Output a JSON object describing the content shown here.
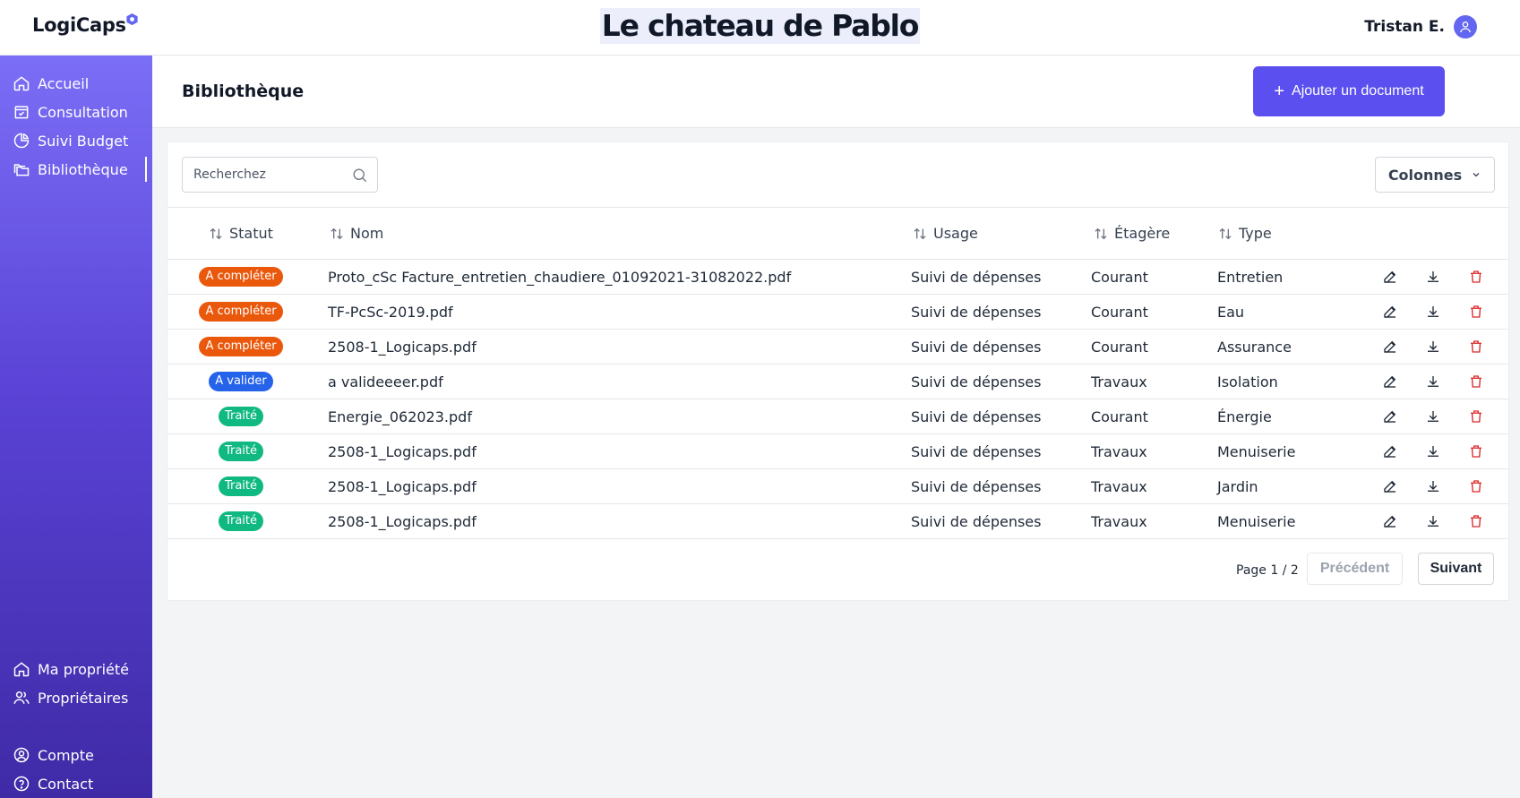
{
  "header": {
    "logo": "LogiCaps",
    "site_title": "Le chateau de Pablo",
    "user_name": "Tristan E.",
    "logo_icon": "hexagon-icon",
    "avatar_icon": "user-icon"
  },
  "sidebar": {
    "top_items": [
      {
        "label": "Accueil",
        "icon": "home-icon"
      },
      {
        "label": "Consultation",
        "icon": "calendar-check-icon"
      },
      {
        "label": "Suivi Budget",
        "icon": "pie-chart-icon"
      },
      {
        "label": "Bibliothèque",
        "icon": "folders-icon",
        "active": true
      }
    ],
    "bottom_items": [
      {
        "label": "Ma propriété",
        "icon": "home-icon"
      },
      {
        "label": "Propriétaires",
        "icon": "users-icon"
      },
      {
        "label": "Compte",
        "icon": "user-circle-icon"
      },
      {
        "label": "Contact",
        "icon": "help-circle-icon"
      }
    ]
  },
  "page": {
    "title": "Bibliothèque",
    "add_button": "Ajouter un document"
  },
  "toolbar": {
    "search_placeholder": "Recherchez",
    "columns_button": "Colonnes"
  },
  "table": {
    "headers": [
      "Statut",
      "Nom",
      "Usage",
      "Étagère",
      "Type"
    ],
    "rows": [
      {
        "status": "A compléter",
        "status_color": "#ea580c",
        "name": "Proto_cSc Facture_entretien_chaudiere_01092021-31082022.pdf",
        "usage": "Suivi de dépenses",
        "shelf": "Courant",
        "type": "Entretien"
      },
      {
        "status": "A compléter",
        "status_color": "#ea580c",
        "name": "TF-PcSc-2019.pdf",
        "usage": "Suivi de dépenses",
        "shelf": "Courant",
        "type": "Eau"
      },
      {
        "status": "A compléter",
        "status_color": "#ea580c",
        "name": "2508-1_Logicaps.pdf",
        "usage": "Suivi de dépenses",
        "shelf": "Courant",
        "type": "Assurance"
      },
      {
        "status": "A valider",
        "status_color": "#2563eb",
        "name": "a valideeeer.pdf",
        "usage": "Suivi de dépenses",
        "shelf": "Travaux",
        "type": "Isolation"
      },
      {
        "status": "Traité",
        "status_color": "#10b981",
        "name": "Energie_062023.pdf",
        "usage": "Suivi de dépenses",
        "shelf": "Courant",
        "type": "Énergie"
      },
      {
        "status": "Traité",
        "status_color": "#10b981",
        "name": "2508-1_Logicaps.pdf",
        "usage": "Suivi de dépenses",
        "shelf": "Travaux",
        "type": "Menuiserie"
      },
      {
        "status": "Traité",
        "status_color": "#10b981",
        "name": "2508-1_Logicaps.pdf",
        "usage": "Suivi de dépenses",
        "shelf": "Travaux",
        "type": "Jardin"
      },
      {
        "status": "Traité",
        "status_color": "#10b981",
        "name": "2508-1_Logicaps.pdf",
        "usage": "Suivi de dépenses",
        "shelf": "Travaux",
        "type": "Menuiserie"
      }
    ]
  },
  "pagination": {
    "page_text": "Page 1 / 2",
    "prev_label": "Précédent",
    "next_label": "Suivant"
  },
  "colors": {
    "primary": "#5b4ff0",
    "sidebar_top": "#7b6ef6",
    "sidebar_bottom": "#3f2aa6",
    "delete": "#dc2626"
  }
}
